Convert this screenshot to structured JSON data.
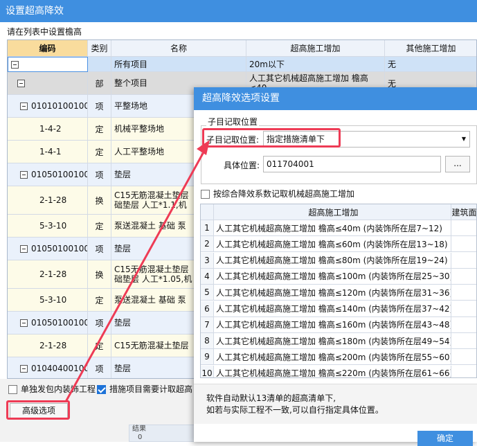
{
  "window": {
    "title": "设置超高降效"
  },
  "hint": "请在列表中设置檐高",
  "grid": {
    "headers": [
      "编码",
      "类别",
      "名称",
      "超高施工增加",
      "其他施工增加"
    ],
    "all_row": {
      "name": "所有项目",
      "v1": "20m以下",
      "v2": "无"
    },
    "rows": [
      {
        "code": "",
        "type": "部",
        "name": "整个项目",
        "v1": "人工其它机械超高施工增加 檐高<40…",
        "v2": "无"
      },
      {
        "code": "010101001001",
        "type": "项",
        "name": "平整场地"
      },
      {
        "code": "1-4-2",
        "type": "定",
        "name": "机械平整场地"
      },
      {
        "code": "1-4-1",
        "type": "定",
        "name": "人工平整场地"
      },
      {
        "code": "010501001001",
        "type": "项",
        "name": "垫层"
      },
      {
        "code": "2-1-28",
        "type": "换",
        "name": "C15无筋混凝土垫层\n础垫层 人工*1.1,机"
      },
      {
        "code": "5-3-10",
        "type": "定",
        "name": "泵送混凝土 基础 泵"
      },
      {
        "code": "010501001002",
        "type": "项",
        "name": "垫层"
      },
      {
        "code": "2-1-28",
        "type": "换",
        "name": "C15无筋混凝土垫层\n础垫层 人工*1.05,机"
      },
      {
        "code": "5-3-10",
        "type": "定",
        "name": "泵送混凝土 基础 泵"
      },
      {
        "code": "010501001003",
        "type": "项",
        "name": "垫层"
      },
      {
        "code": "2-1-28",
        "type": "定",
        "name": "C15无筋混凝土垫层"
      },
      {
        "code": "010404001001",
        "type": "项",
        "name": "垫层"
      }
    ]
  },
  "bottom": {
    "check1": "单独发包内装饰工程",
    "check2": "措施项目需要计取超高",
    "advanced": "高级选项",
    "peek1": "结果",
    "peek2": "0"
  },
  "dialog": {
    "title": "超高降效选项设置",
    "group_label": "子目记取位置",
    "pos_label": "子目记取位置:",
    "pos_value": "指定措施清单下",
    "detail_label": "具体位置:",
    "detail_value": "011704001",
    "browse": "...",
    "checkbox": "按综合降效系数记取机械超高施工增加",
    "col1": "超高施工增加",
    "col2": "建筑面",
    "rows": [
      {
        "n": "1",
        "text": "人工其它机械超高施工增加 檐高≤40m (内装饰所在层7~12)"
      },
      {
        "n": "2",
        "text": "人工其它机械超高施工增加 檐高≤60m (内装饰所在层13~18)"
      },
      {
        "n": "3",
        "text": "人工其它机械超高施工增加 檐高≤80m (内装饰所在层19~24)"
      },
      {
        "n": "4",
        "text": "人工其它机械超高施工增加 檐高≤100m (内装饰所在层25~30)"
      },
      {
        "n": "5",
        "text": "人工其它机械超高施工增加 檐高≤120m (内装饰所在层31~36)"
      },
      {
        "n": "6",
        "text": "人工其它机械超高施工增加 檐高≤140m (内装饰所在层37~42)"
      },
      {
        "n": "7",
        "text": "人工其它机械超高施工增加 檐高≤160m (内装饰所在层43~48)"
      },
      {
        "n": "8",
        "text": "人工其它机械超高施工增加 檐高≤180m (内装饰所在层49~54)"
      },
      {
        "n": "9",
        "text": "人工其它机械超高施工增加 檐高≤200m (内装饰所在层55~60)"
      },
      {
        "n": "10",
        "text": "人工其它机械超高施工增加 檐高≤220m (内装饰所在层61~66)"
      }
    ],
    "note1": "软件自动默认13清单的超高清单下,",
    "note2": "如若与实际工程不一致,可以自行指定具体位置。",
    "ok": "确定"
  },
  "colors": {
    "accent": "#3f8fe0",
    "highlight": "#ee3b55"
  }
}
